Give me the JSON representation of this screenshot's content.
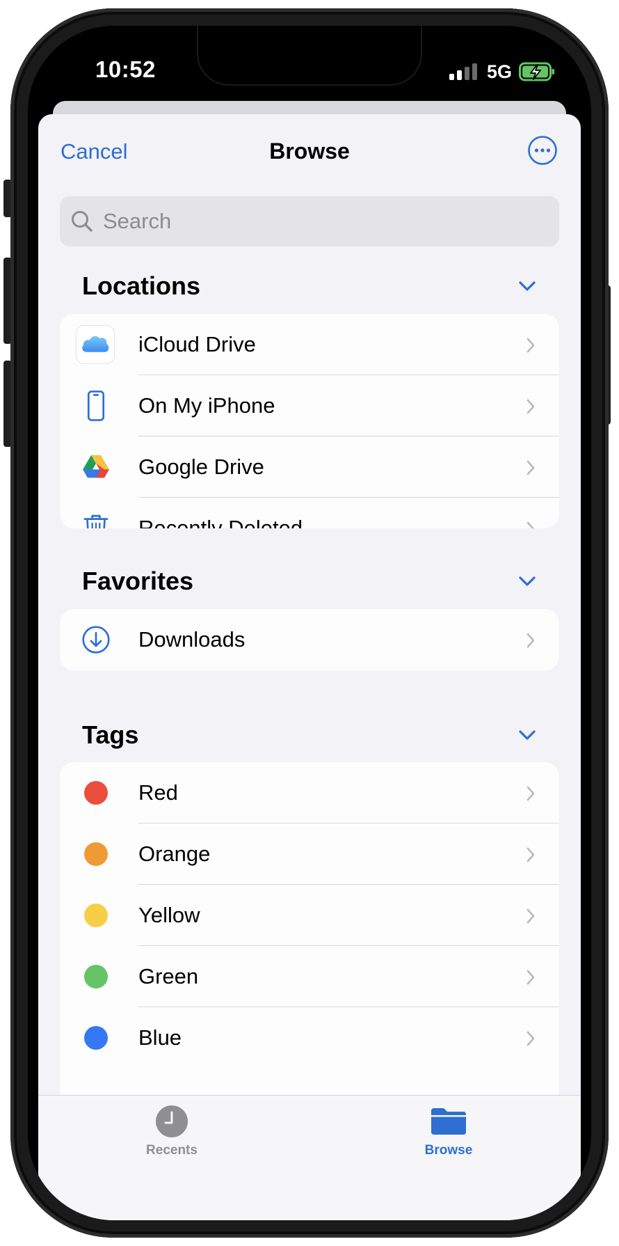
{
  "status_bar": {
    "time": "10:52",
    "network": "5G"
  },
  "header": {
    "cancel_label": "Cancel",
    "title": "Browse",
    "more_icon": "ellipsis-circle-icon"
  },
  "search": {
    "placeholder": "Search",
    "value": ""
  },
  "locations": {
    "title": "Locations",
    "items": [
      {
        "label": "iCloud Drive",
        "icon": "icloud-icon"
      },
      {
        "label": "On My iPhone",
        "icon": "iphone-icon"
      },
      {
        "label": "Google Drive",
        "icon": "google-drive-icon"
      },
      {
        "label": "Recently Deleted",
        "icon": "trash-icon"
      }
    ]
  },
  "favorites": {
    "title": "Favorites",
    "items": [
      {
        "label": "Downloads",
        "icon": "download-circle-icon"
      }
    ]
  },
  "tags": {
    "title": "Tags",
    "items": [
      {
        "label": "Red",
        "color": "#eb4e3d"
      },
      {
        "label": "Orange",
        "color": "#f09a37"
      },
      {
        "label": "Yellow",
        "color": "#f7cf46"
      },
      {
        "label": "Green",
        "color": "#65c466"
      },
      {
        "label": "Blue",
        "color": "#3478f6"
      }
    ]
  },
  "tabbar": {
    "recents_label": "Recents",
    "browse_label": "Browse",
    "active_tab": "Browse"
  },
  "colors": {
    "accent": "#2e6fd1",
    "inactive": "#8e8e93"
  }
}
